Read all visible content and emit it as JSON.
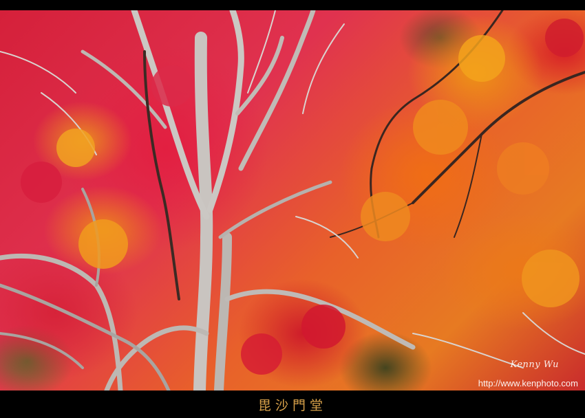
{
  "photo": {
    "title": "毘沙門堂",
    "signature": "Kenny Wu",
    "url": "http://www.kenphoto.com"
  },
  "colors": {
    "frame": "#000000",
    "caption": "#d9a24a",
    "foliage_red": "#e0324f",
    "foliage_orange": "#e8612a",
    "trunk": "#c9c4c0"
  }
}
